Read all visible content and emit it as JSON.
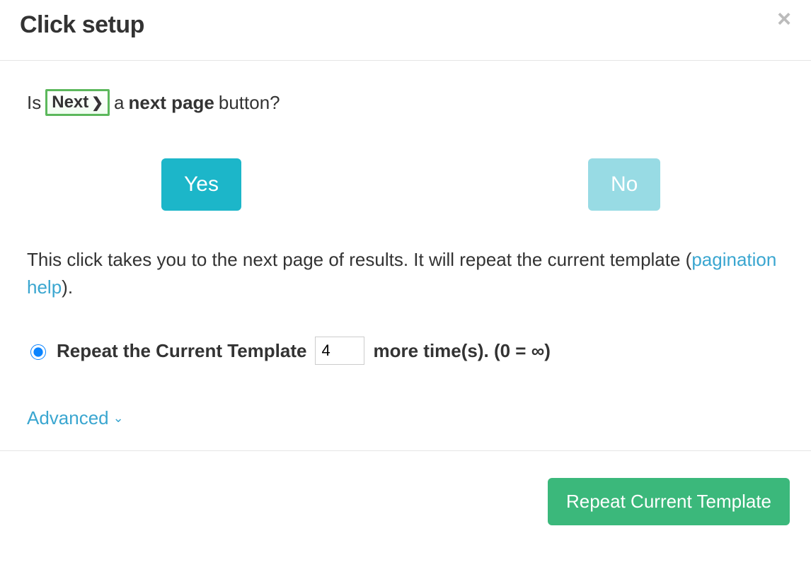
{
  "header": {
    "title": "Click setup"
  },
  "question": {
    "prefix": "Is",
    "chip_label": "Next",
    "mid": "a",
    "bold": "next page",
    "suffix": "button?"
  },
  "buttons": {
    "yes": "Yes",
    "no": "No"
  },
  "description": {
    "text1": "This click takes you to the next page of results. It will repeat the current template (",
    "link": "pagination help",
    "text2": ")."
  },
  "repeat": {
    "label_before": "Repeat the Current Template",
    "value": "4",
    "label_after": "more time(s). (0 = ∞)"
  },
  "advanced": {
    "label": "Advanced"
  },
  "footer": {
    "primary": "Repeat Current Template"
  }
}
